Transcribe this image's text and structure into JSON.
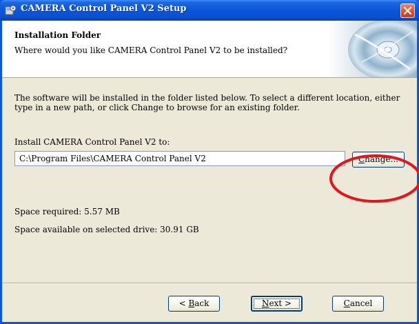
{
  "window": {
    "title": "CAMERA Control Panel V2 Setup",
    "icon": "installer-app-icon",
    "close_icon": "close-icon"
  },
  "header": {
    "title": "Installation Folder",
    "subtitle": "Where would you like CAMERA Control Panel V2 to be installed?",
    "art": "cd-disc-graphic"
  },
  "body": {
    "description": "The software will be installed in the folder listed below. To select a different location, either type in a new path, or click Change to browse for an existing folder.",
    "install_label": "Install CAMERA Control Panel V2 to:",
    "install_path": "C:\\Program Files\\CAMERA Control Panel V2",
    "change_button": {
      "pre": "",
      "accel": "C",
      "post": "hange..."
    },
    "space_required": "Space required: 5.57 MB",
    "space_available": "Space available on selected drive: 30.91 GB"
  },
  "footer": {
    "back_button": {
      "pre": "< ",
      "accel": "B",
      "post": "ack"
    },
    "next_button": {
      "pre": "",
      "accel": "N",
      "post": "ext >"
    },
    "cancel_button": {
      "pre": "",
      "accel": "C",
      "post": "ancel"
    }
  },
  "colors": {
    "titlebar": "#0a56d8",
    "dialog_bg": "#ece9d8",
    "annotation_circle": "#e8141c"
  }
}
